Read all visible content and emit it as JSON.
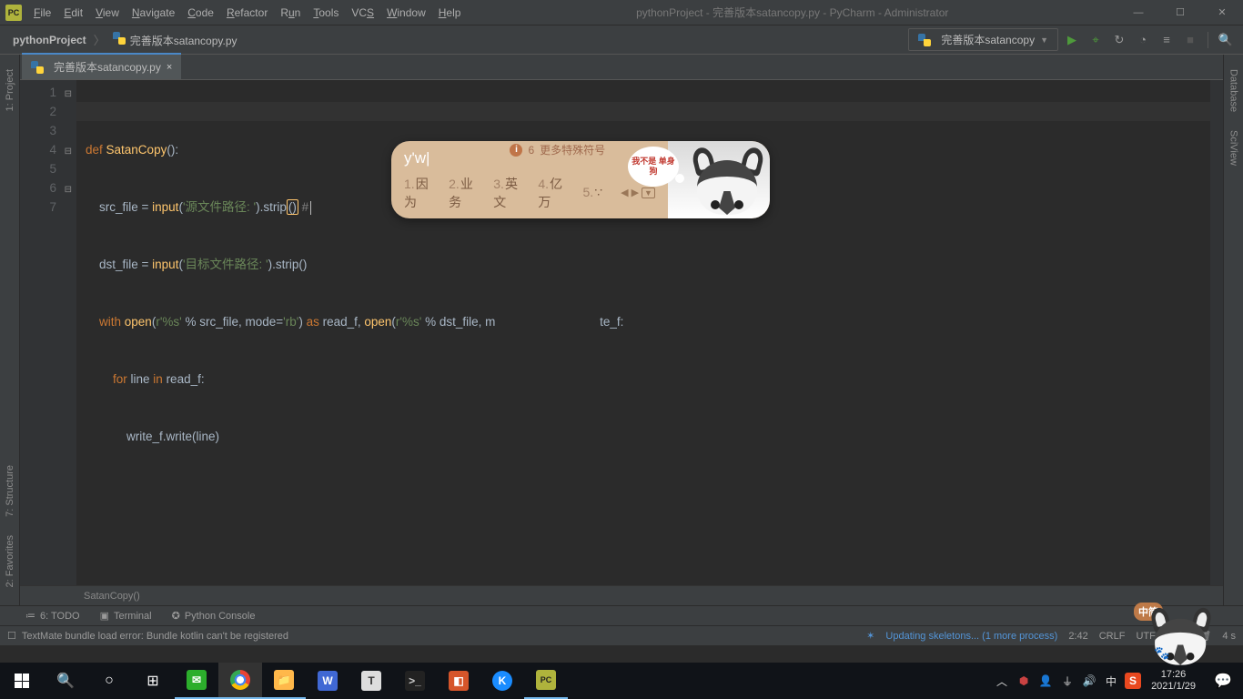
{
  "window": {
    "title_project": "pythonProject",
    "title_file": "完善版本satancopy.py",
    "title_app": "PyCharm",
    "title_admin": "Administrator"
  },
  "menu": {
    "file": "File",
    "edit": "Edit",
    "view": "View",
    "navigate": "Navigate",
    "code": "Code",
    "refactor": "Refactor",
    "run": "Run",
    "tools": "Tools",
    "vcs": "VCS",
    "window": "Window",
    "help": "Help"
  },
  "breadcrumb": {
    "root": "pythonProject",
    "file": "完善版本satancopy.py"
  },
  "run_config": {
    "label": "完善版本satancopy"
  },
  "tab": {
    "name": "完善版本satancopy.py"
  },
  "side": {
    "project": "1: Project",
    "structure": "7: Structure",
    "favorites": "2: Favorites",
    "database": "Database",
    "sciview": "SciView"
  },
  "code": {
    "l1_def": "def ",
    "l1_fn": "SatanCopy",
    "l1_tail": "():",
    "l2_a": "    src_file = ",
    "l2_fn": "input",
    "l2_p1": "(",
    "l2_s": "'源文件路径: '",
    "l2_p2": ").strip",
    "l2_paren": "()",
    "l2_c": " #",
    "l3_a": "    dst_file = ",
    "l3_fn": "input",
    "l3_p1": "(",
    "l3_s": "'目标文件路径: '",
    "l3_p2": ").strip()",
    "l4_a": "    ",
    "l4_with": "with ",
    "l4_open": "open",
    "l4_p1": "(",
    "l4_s1": "r'%s'",
    "l4_mid": " % src_file, mode=",
    "l4_s2": "'rb'",
    "l4_p2": ") ",
    "l4_as": "as ",
    "l4_rf": "read_f, ",
    "l4_open2": "open",
    "l4_p3": "(",
    "l4_s3": "r'%s'",
    "l4_mid2": " % dst_file, m",
    "l4_tail": "te_f:",
    "l5_a": "        ",
    "l5_for": "for ",
    "l5_mid": "line ",
    "l5_in": "in ",
    "l5_r": "read_f:",
    "l6": "            write_f.write(line)",
    "breadcrumb_fn": "SatanCopy()"
  },
  "line_numbers": [
    "1",
    "2",
    "3",
    "4",
    "5",
    "6",
    "7"
  ],
  "ime": {
    "input": "y'w",
    "info_num": "6",
    "info_text": "更多特殊符号",
    "bubble": "我不是\n单身狗",
    "cands": [
      {
        "n": "1.",
        "t": "因为"
      },
      {
        "n": "2.",
        "t": "业务"
      },
      {
        "n": "3.",
        "t": "英文"
      },
      {
        "n": "4.",
        "t": "亿万"
      },
      {
        "n": "5.",
        "t": "∵"
      }
    ]
  },
  "tool_windows": {
    "todo": "6: TODO",
    "terminal": "Terminal",
    "pyconsole": "Python Console"
  },
  "status": {
    "error": "TextMate bundle load error: Bundle kotlin can't be registered",
    "updating": "Updating skeletons... (1 more process)",
    "pos": "2:42",
    "eol": "CRLF",
    "enc": "UTF-8",
    "spaces": "4 s"
  },
  "taskbar": {
    "time": "17:26",
    "date": "2021/1/29"
  },
  "mascot_badge": "中简"
}
